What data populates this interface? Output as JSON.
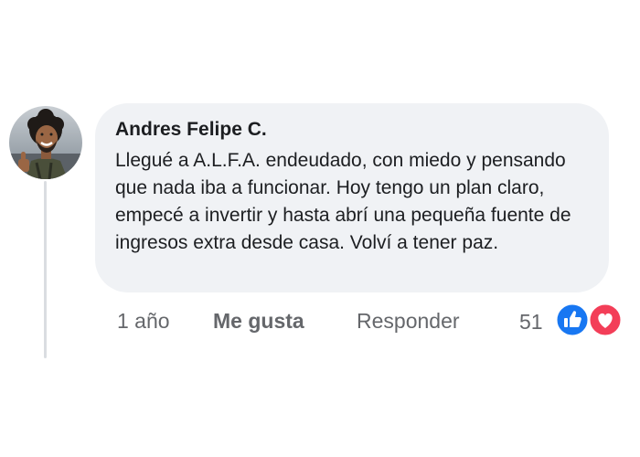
{
  "comment": {
    "author": "Andres Felipe C.",
    "text": "Llegué a A.L.F.A. endeudado, con miedo y pensando que nada iba a funcionar. Hoy tengo un plan claro, empecé a invertir y hasta abrí una pequeña fuente de ingresos extra desde casa. Volví a tener paz."
  },
  "actions": {
    "time": "1 año",
    "like_label": "Me gusta",
    "reply_label": "Responder"
  },
  "reactions": {
    "count": "51",
    "icons": [
      "thumbs-up-icon",
      "heart-icon"
    ],
    "like_color": "#1877f2",
    "love_color": "#f33e58"
  },
  "colors": {
    "bubble_bg": "#f0f2f5",
    "text": "#1c1e21",
    "secondary_text": "#65676b"
  }
}
